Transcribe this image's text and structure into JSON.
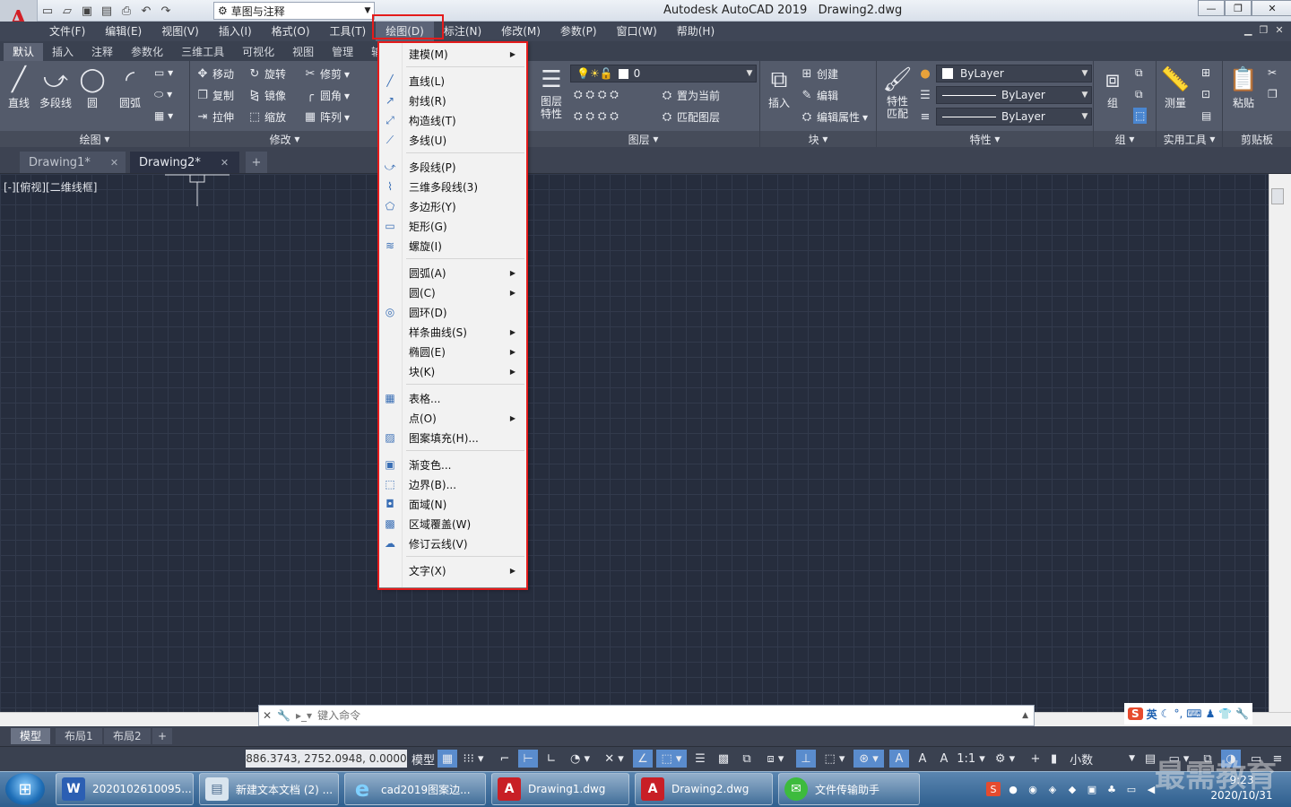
{
  "window": {
    "app_title": "Autodesk AutoCAD 2019",
    "doc_title": "Drawing2.dwg",
    "logo_letter": "A",
    "workspace": "草图与注释"
  },
  "menubar": [
    "文件(F)",
    "编辑(E)",
    "视图(V)",
    "插入(I)",
    "格式(O)",
    "工具(T)",
    "绘图(D)",
    "标注(N)",
    "修改(M)",
    "参数(P)",
    "窗口(W)",
    "帮助(H)"
  ],
  "ribbon_tabs": [
    "默认",
    "插入",
    "注释",
    "参数化",
    "三维工具",
    "可视化",
    "视图",
    "管理",
    "输"
  ],
  "ribbon": {
    "draw": {
      "title": "绘图",
      "line": "直线",
      "polyline": "多段线",
      "circle": "圆",
      "arc": "圆弧"
    },
    "modify": {
      "title": "修改",
      "move": "移动",
      "rotate": "旋转",
      "trim": "修剪",
      "copy": "复制",
      "mirror": "镜像",
      "fillet": "圆角",
      "stretch": "拉伸",
      "scale": "缩放",
      "array": "阵列"
    },
    "layers": {
      "title": "图层",
      "props_line1": "图层",
      "props_line2": "特性",
      "layer_value": "0",
      "set_current": "置为当前",
      "match_layer": "匹配图层"
    },
    "block": {
      "title": "块",
      "insert": "插入",
      "create": "创建",
      "edit": "编辑",
      "edit_attr": "编辑属性"
    },
    "properties": {
      "title": "特性",
      "match_line1": "特性",
      "match_line2": "匹配",
      "color": "ByLayer",
      "linetype": "ByLayer",
      "lineweight": "ByLayer"
    },
    "groups": {
      "title": "组",
      "group": "组"
    },
    "utilities": {
      "title": "实用工具",
      "measure": "测量"
    },
    "clipboard": {
      "title": "剪贴板",
      "paste": "粘贴"
    }
  },
  "doc_tabs": [
    {
      "label": "Drawing1*"
    },
    {
      "label": "Drawing2*"
    }
  ],
  "viewport_label": "[-][俯视][二维线框]",
  "command_line": {
    "placeholder": "键入命令"
  },
  "layout_tabs": [
    "模型",
    "布局1",
    "布局2"
  ],
  "status": {
    "coords": "886.3743, 2752.0948, 0.0000",
    "model": "模型",
    "scale": "1:1",
    "units": "小数"
  },
  "draw_menu": {
    "groups": [
      [
        {
          "label": "建模(M)",
          "icon": "",
          "submenu": true
        }
      ],
      [
        {
          "label": "直线(L)",
          "icon": "line-icon"
        },
        {
          "label": "射线(R)",
          "icon": "ray-icon"
        },
        {
          "label": "构造线(T)",
          "icon": "xline-icon"
        },
        {
          "label": "多线(U)",
          "icon": "mline-icon"
        }
      ],
      [
        {
          "label": "多段线(P)",
          "icon": "polyline-icon"
        },
        {
          "label": "三维多段线(3)",
          "icon": "3dpoly-icon"
        },
        {
          "label": "多边形(Y)",
          "icon": "polygon-icon"
        },
        {
          "label": "矩形(G)",
          "icon": "rectangle-icon"
        },
        {
          "label": "螺旋(I)",
          "icon": "helix-icon"
        }
      ],
      [
        {
          "label": "圆弧(A)",
          "icon": "",
          "submenu": true
        },
        {
          "label": "圆(C)",
          "icon": "",
          "submenu": true
        },
        {
          "label": "圆环(D)",
          "icon": "donut-icon"
        },
        {
          "label": "样条曲线(S)",
          "icon": "",
          "submenu": true
        },
        {
          "label": "椭圆(E)",
          "icon": "",
          "submenu": true
        },
        {
          "label": "块(K)",
          "icon": "",
          "submenu": true
        }
      ],
      [
        {
          "label": "表格...",
          "icon": "table-icon"
        },
        {
          "label": "点(O)",
          "icon": "",
          "submenu": true
        },
        {
          "label": "图案填充(H)...",
          "icon": "hatch-icon"
        }
      ],
      [
        {
          "label": "渐变色...",
          "icon": "gradient-icon"
        },
        {
          "label": "边界(B)...",
          "icon": "boundary-icon"
        },
        {
          "label": "面域(N)",
          "icon": "region-icon"
        },
        {
          "label": "区域覆盖(W)",
          "icon": "wipeout-icon"
        },
        {
          "label": "修订云线(V)",
          "icon": "revcloud-icon"
        }
      ],
      [
        {
          "label": "文字(X)",
          "icon": "",
          "submenu": true
        }
      ]
    ]
  },
  "taskbar": {
    "items": [
      "2020102610095...",
      "新建文本文档 (2) ...",
      "cad2019图案边...",
      "Drawing1.dwg",
      "Drawing2.dwg",
      "文件传输助手"
    ],
    "time": "9:23",
    "date": "2020/10/31",
    "ime_label": "英"
  },
  "watermark": "最需教育",
  "colors": {
    "highlight_box": "#e41b1b",
    "canvas_bg": "#262d3d",
    "menubar_bg": "#3f4656"
  }
}
